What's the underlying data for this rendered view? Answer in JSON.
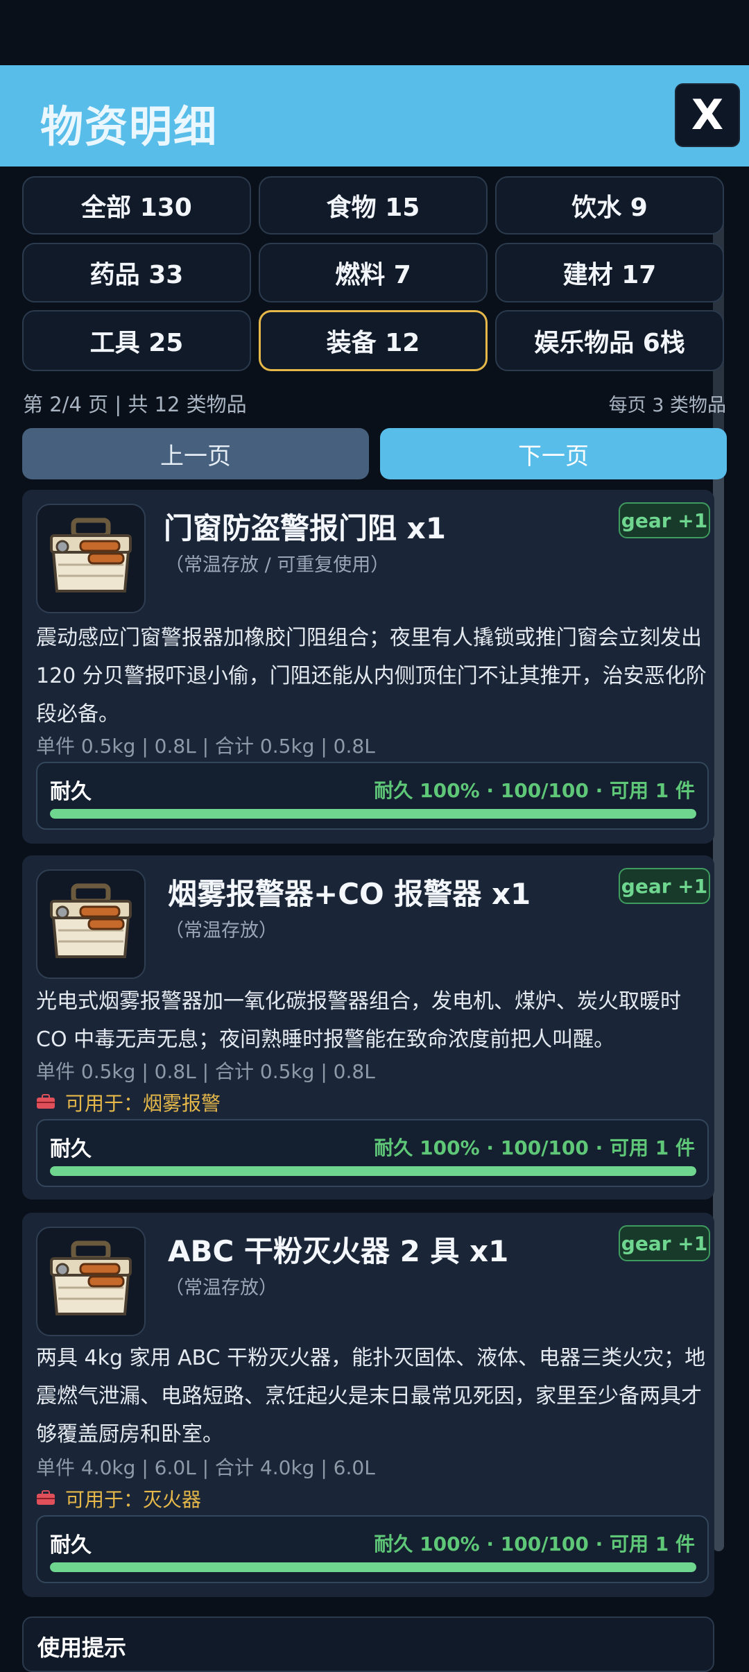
{
  "header": {
    "title": "物资明细",
    "close_label": "X"
  },
  "categories": [
    {
      "label": "全部 130",
      "active": false
    },
    {
      "label": "食物 15",
      "active": false
    },
    {
      "label": "饮水 9",
      "active": false
    },
    {
      "label": "药品 33",
      "active": false
    },
    {
      "label": "燃料 7",
      "active": false
    },
    {
      "label": "建材 17",
      "active": false
    },
    {
      "label": "工具 25",
      "active": false
    },
    {
      "label": "装备 12",
      "active": true
    },
    {
      "label": "娱乐物品 6栈",
      "active": false
    }
  ],
  "pagination": {
    "info": "第 2/4 页 | 共 12 类物品",
    "per_page": "每页 3 类物品",
    "prev_label": "上一页",
    "next_label": "下一页"
  },
  "items": [
    {
      "name": "门窗防盗警报门阻 x1",
      "sub": "（常温存放 / 可重复使用）",
      "badge": "gear +1",
      "desc": "震动感应门窗警报器加橡胶门阻组合；夜里有人撬锁或推门窗会立刻发出 120 分贝警报吓退小偷，门阻还能从内侧顶住门不让其推开，治安恶化阶段必备。",
      "weight": "单件 0.5kg | 0.8L | 合计 0.5kg | 0.8L",
      "use_for": "",
      "dur_label": "耐久",
      "dur_stats": "耐久 100% · 100/100 · 可用 1 件",
      "durability": 1.0,
      "icon": "toolbox-icon"
    },
    {
      "name": "烟雾报警器+CO 报警器 x1",
      "sub": "（常温存放）",
      "badge": "gear +1",
      "desc": "光电式烟雾报警器加一氧化碳报警器组合，发电机、煤炉、炭火取暖时 CO 中毒无声无息；夜间熟睡时报警能在致命浓度前把人叫醒。",
      "weight": "单件 0.5kg | 0.8L | 合计 0.5kg | 0.8L",
      "use_for": "可用于：烟雾报警",
      "dur_label": "耐久",
      "dur_stats": "耐久 100% · 100/100 · 可用 1 件",
      "durability": 1.0,
      "icon": "toolbox-icon"
    },
    {
      "name": "ABC 干粉灭火器 2 具 x1",
      "sub": "（常温存放）",
      "badge": "gear +1",
      "desc": "两具 4kg 家用 ABC 干粉灭火器，能扑灭固体、液体、电器三类火灾；地震燃气泄漏、电路短路、烹饪起火是末日最常见死因，家里至少备两具才够覆盖厨房和卧室。",
      "weight": "单件 4.0kg | 6.0L | 合计 4.0kg | 6.0L",
      "use_for": "可用于：灭火器",
      "dur_label": "耐久",
      "dur_stats": "耐久 100% · 100/100 · 可用 1 件",
      "durability": 1.0,
      "icon": "toolbox-icon"
    }
  ],
  "tip": {
    "title": "使用提示"
  },
  "colors": {
    "accent": "#58bde9",
    "active_border": "#e6b84a",
    "durability": "#6fd68f",
    "card": "#1a2638"
  }
}
